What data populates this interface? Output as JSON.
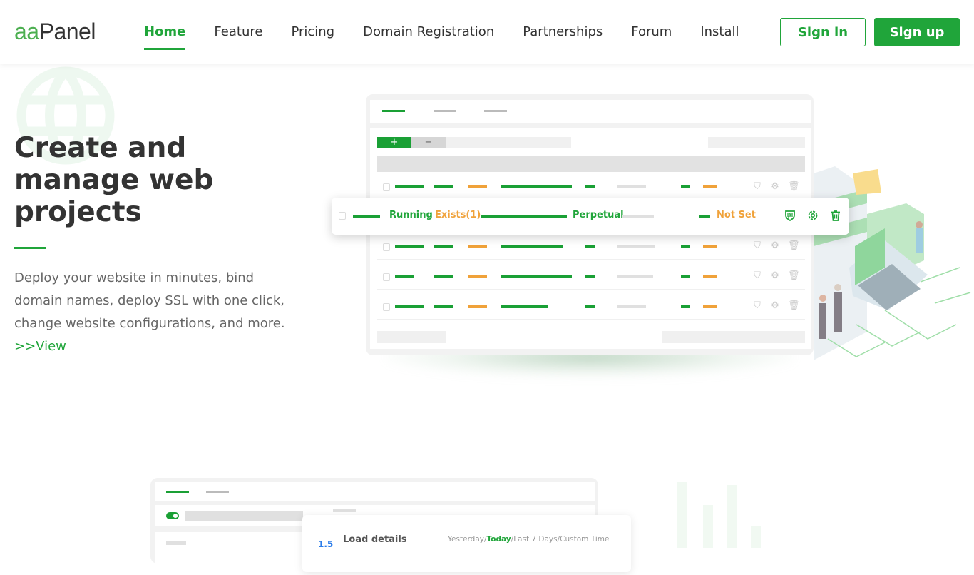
{
  "header": {
    "logo_part1": "aa",
    "logo_part2": "Panel",
    "nav": [
      {
        "label": "Home",
        "active": true
      },
      {
        "label": "Feature",
        "active": false
      },
      {
        "label": "Pricing",
        "active": false
      },
      {
        "label": "Domain Registration",
        "active": false
      },
      {
        "label": "Partnerships",
        "active": false
      },
      {
        "label": "Forum",
        "active": false
      },
      {
        "label": "Install",
        "active": false
      }
    ],
    "sign_in": "Sign in",
    "sign_up": "Sign up"
  },
  "hero": {
    "icon": "globe-icon",
    "title": "Create and manage web projects",
    "description": "Deploy your website in minutes, bind domain names, deploy SSL with one click, change website configurations, and more.",
    "link": ">>View"
  },
  "site_mockup": {
    "add_button": "+",
    "remove_button": "−",
    "highlighted_row": {
      "status": "Running",
      "backup": "Exists(1)",
      "expiry": "Perpetual",
      "ssl": "Not Set",
      "actions": [
        "firewall-icon",
        "gear-icon",
        "trash-icon"
      ]
    },
    "placeholder_rows": 4
  },
  "load_mockup": {
    "value": "1.5",
    "title": "Load details",
    "ranges": [
      "Yesterday",
      "Today",
      "Last 7 Days",
      "Custom Time"
    ],
    "selected_range": "Today",
    "separator": "/"
  },
  "colors": {
    "brand": "#20a53a",
    "warning": "#f0a23a",
    "text": "#333333",
    "muted": "#666666",
    "info": "#2b7ce9"
  }
}
